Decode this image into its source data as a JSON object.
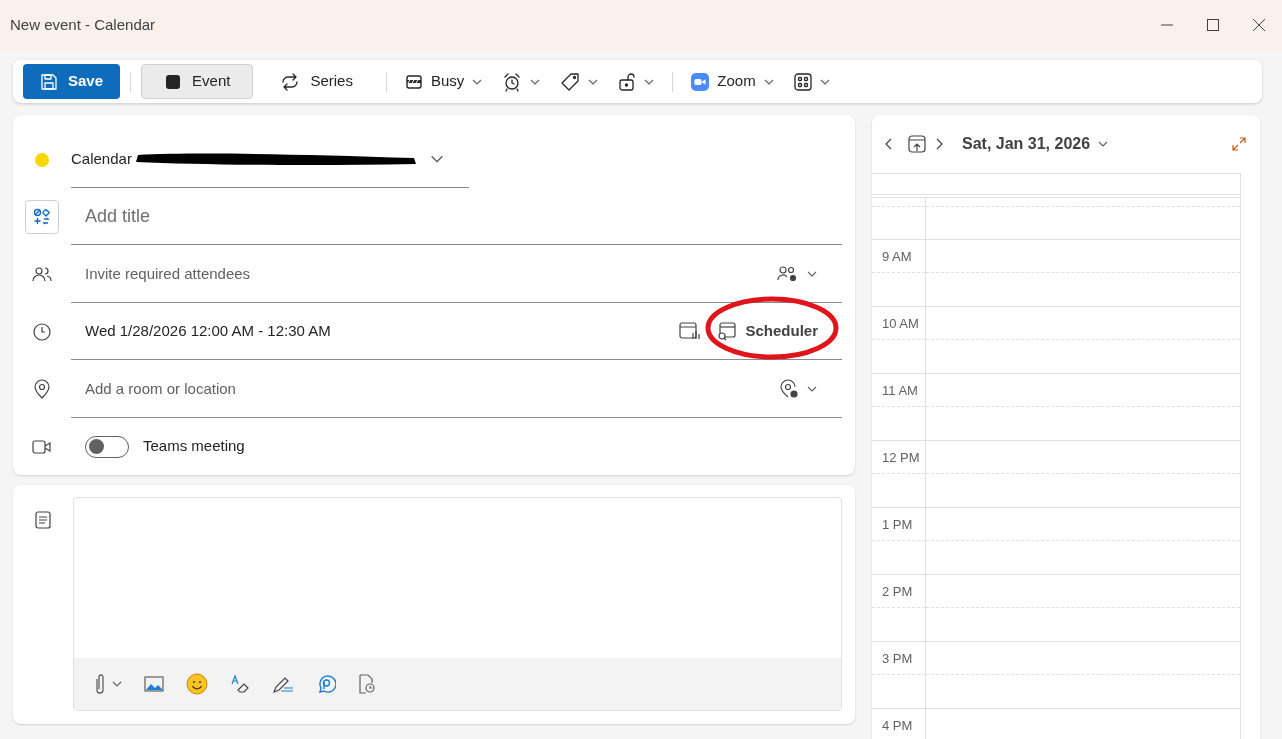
{
  "window": {
    "title": "New event - Calendar"
  },
  "toolbar": [
    {
      "kind": "primary",
      "label": "Save"
    },
    {
      "kind": "divider"
    },
    {
      "kind": "toggle",
      "label": "Event",
      "selected": true
    },
    {
      "kind": "toggle",
      "label": "Series",
      "selected": false
    },
    {
      "kind": "divider"
    },
    {
      "kind": "menu",
      "label": "Busy"
    },
    {
      "kind": "menu"
    },
    {
      "kind": "menu"
    },
    {
      "kind": "menu"
    },
    {
      "kind": "divider"
    },
    {
      "kind": "menu",
      "label": "Zoom"
    },
    {
      "kind": "menu"
    }
  ],
  "form": {
    "calendar": {
      "label": "Calendar",
      "color": "#f5d800",
      "redacted": true
    },
    "title": {
      "placeholder": "Add title"
    },
    "attendees": {
      "placeholder": "Invite required attendees"
    },
    "time": {
      "value": "Wed 1/28/2026 12:00 AM - 12:30 AM",
      "scheduler": "Scheduler",
      "circled": true
    },
    "location": {
      "placeholder": "Add a room or location"
    },
    "teams": {
      "label": "Teams meeting",
      "on": false
    }
  },
  "day_view": {
    "date": "Sat, Jan 31, 2026",
    "hours": [
      "9 AM",
      "10 AM",
      "11 AM",
      "12 PM",
      "1 PM",
      "2 PM",
      "3 PM",
      "4 PM"
    ]
  }
}
